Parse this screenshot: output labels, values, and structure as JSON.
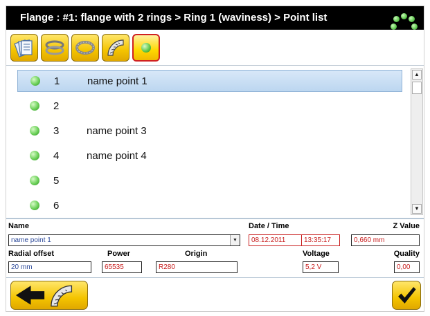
{
  "title": "Flange :  #1: flange with 2 rings > Ring 1 (waviness) > Point list",
  "colors": {
    "accent_yellow": "#f4c400",
    "selection_blue": "#c7dcf2",
    "status_green": "#63c94d",
    "value_red": "#c81d1d",
    "value_blue": "#2d4a9a"
  },
  "toolbar": {
    "buttons": [
      {
        "icon": "flange-list-icon"
      },
      {
        "icon": "rings-icon"
      },
      {
        "icon": "ring-icon"
      },
      {
        "icon": "ring-segment-icon"
      },
      {
        "icon": "point-icon",
        "active": true
      }
    ]
  },
  "points": [
    {
      "num": "1",
      "name": "name point 1",
      "selected": true
    },
    {
      "num": "2",
      "name": ""
    },
    {
      "num": "3",
      "name": "name point 3"
    },
    {
      "num": "4",
      "name": "name point 4"
    },
    {
      "num": "5",
      "name": ""
    },
    {
      "num": "6",
      "name": ""
    }
  ],
  "details": {
    "name_label": "Name",
    "name_value": "name point 1",
    "datetime_label": "Date / Time",
    "date_value": "08.12.2011",
    "time_value": "13:35:17",
    "zvalue_label": "Z Value",
    "zvalue_value": "0,660 mm",
    "radial_label": "Radial offset",
    "radial_value": "20 mm",
    "power_label": "Power",
    "power_value": "65535",
    "origin_label": "Origin",
    "origin_value": "R280",
    "voltage_label": "Voltage",
    "voltage_value": "5,2 V",
    "quality_label": "Quality",
    "quality_value": "0,00"
  },
  "footer": {
    "back_icon": "back-arrow-icon",
    "ring_icon": "ring-segment-icon",
    "confirm_icon": "checkmark-icon"
  }
}
